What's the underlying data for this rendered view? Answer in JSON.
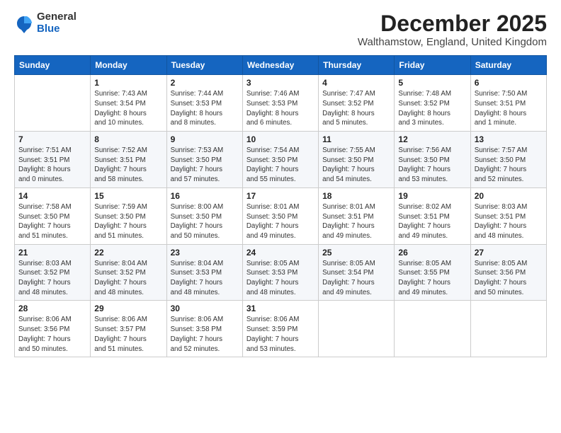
{
  "logo": {
    "general": "General",
    "blue": "Blue"
  },
  "title": "December 2025",
  "location": "Walthamstow, England, United Kingdom",
  "days_of_week": [
    "Sunday",
    "Monday",
    "Tuesday",
    "Wednesday",
    "Thursday",
    "Friday",
    "Saturday"
  ],
  "weeks": [
    [
      {
        "day": "",
        "detail": ""
      },
      {
        "day": "1",
        "detail": "Sunrise: 7:43 AM\nSunset: 3:54 PM\nDaylight: 8 hours\nand 10 minutes."
      },
      {
        "day": "2",
        "detail": "Sunrise: 7:44 AM\nSunset: 3:53 PM\nDaylight: 8 hours\nand 8 minutes."
      },
      {
        "day": "3",
        "detail": "Sunrise: 7:46 AM\nSunset: 3:53 PM\nDaylight: 8 hours\nand 6 minutes."
      },
      {
        "day": "4",
        "detail": "Sunrise: 7:47 AM\nSunset: 3:52 PM\nDaylight: 8 hours\nand 5 minutes."
      },
      {
        "day": "5",
        "detail": "Sunrise: 7:48 AM\nSunset: 3:52 PM\nDaylight: 8 hours\nand 3 minutes."
      },
      {
        "day": "6",
        "detail": "Sunrise: 7:50 AM\nSunset: 3:51 PM\nDaylight: 8 hours\nand 1 minute."
      }
    ],
    [
      {
        "day": "7",
        "detail": "Sunrise: 7:51 AM\nSunset: 3:51 PM\nDaylight: 8 hours\nand 0 minutes."
      },
      {
        "day": "8",
        "detail": "Sunrise: 7:52 AM\nSunset: 3:51 PM\nDaylight: 7 hours\nand 58 minutes."
      },
      {
        "day": "9",
        "detail": "Sunrise: 7:53 AM\nSunset: 3:50 PM\nDaylight: 7 hours\nand 57 minutes."
      },
      {
        "day": "10",
        "detail": "Sunrise: 7:54 AM\nSunset: 3:50 PM\nDaylight: 7 hours\nand 55 minutes."
      },
      {
        "day": "11",
        "detail": "Sunrise: 7:55 AM\nSunset: 3:50 PM\nDaylight: 7 hours\nand 54 minutes."
      },
      {
        "day": "12",
        "detail": "Sunrise: 7:56 AM\nSunset: 3:50 PM\nDaylight: 7 hours\nand 53 minutes."
      },
      {
        "day": "13",
        "detail": "Sunrise: 7:57 AM\nSunset: 3:50 PM\nDaylight: 7 hours\nand 52 minutes."
      }
    ],
    [
      {
        "day": "14",
        "detail": "Sunrise: 7:58 AM\nSunset: 3:50 PM\nDaylight: 7 hours\nand 51 minutes."
      },
      {
        "day": "15",
        "detail": "Sunrise: 7:59 AM\nSunset: 3:50 PM\nDaylight: 7 hours\nand 51 minutes."
      },
      {
        "day": "16",
        "detail": "Sunrise: 8:00 AM\nSunset: 3:50 PM\nDaylight: 7 hours\nand 50 minutes."
      },
      {
        "day": "17",
        "detail": "Sunrise: 8:01 AM\nSunset: 3:50 PM\nDaylight: 7 hours\nand 49 minutes."
      },
      {
        "day": "18",
        "detail": "Sunrise: 8:01 AM\nSunset: 3:51 PM\nDaylight: 7 hours\nand 49 minutes."
      },
      {
        "day": "19",
        "detail": "Sunrise: 8:02 AM\nSunset: 3:51 PM\nDaylight: 7 hours\nand 49 minutes."
      },
      {
        "day": "20",
        "detail": "Sunrise: 8:03 AM\nSunset: 3:51 PM\nDaylight: 7 hours\nand 48 minutes."
      }
    ],
    [
      {
        "day": "21",
        "detail": "Sunrise: 8:03 AM\nSunset: 3:52 PM\nDaylight: 7 hours\nand 48 minutes."
      },
      {
        "day": "22",
        "detail": "Sunrise: 8:04 AM\nSunset: 3:52 PM\nDaylight: 7 hours\nand 48 minutes."
      },
      {
        "day": "23",
        "detail": "Sunrise: 8:04 AM\nSunset: 3:53 PM\nDaylight: 7 hours\nand 48 minutes."
      },
      {
        "day": "24",
        "detail": "Sunrise: 8:05 AM\nSunset: 3:53 PM\nDaylight: 7 hours\nand 48 minutes."
      },
      {
        "day": "25",
        "detail": "Sunrise: 8:05 AM\nSunset: 3:54 PM\nDaylight: 7 hours\nand 49 minutes."
      },
      {
        "day": "26",
        "detail": "Sunrise: 8:05 AM\nSunset: 3:55 PM\nDaylight: 7 hours\nand 49 minutes."
      },
      {
        "day": "27",
        "detail": "Sunrise: 8:05 AM\nSunset: 3:56 PM\nDaylight: 7 hours\nand 50 minutes."
      }
    ],
    [
      {
        "day": "28",
        "detail": "Sunrise: 8:06 AM\nSunset: 3:56 PM\nDaylight: 7 hours\nand 50 minutes."
      },
      {
        "day": "29",
        "detail": "Sunrise: 8:06 AM\nSunset: 3:57 PM\nDaylight: 7 hours\nand 51 minutes."
      },
      {
        "day": "30",
        "detail": "Sunrise: 8:06 AM\nSunset: 3:58 PM\nDaylight: 7 hours\nand 52 minutes."
      },
      {
        "day": "31",
        "detail": "Sunrise: 8:06 AM\nSunset: 3:59 PM\nDaylight: 7 hours\nand 53 minutes."
      },
      {
        "day": "",
        "detail": ""
      },
      {
        "day": "",
        "detail": ""
      },
      {
        "day": "",
        "detail": ""
      }
    ]
  ]
}
